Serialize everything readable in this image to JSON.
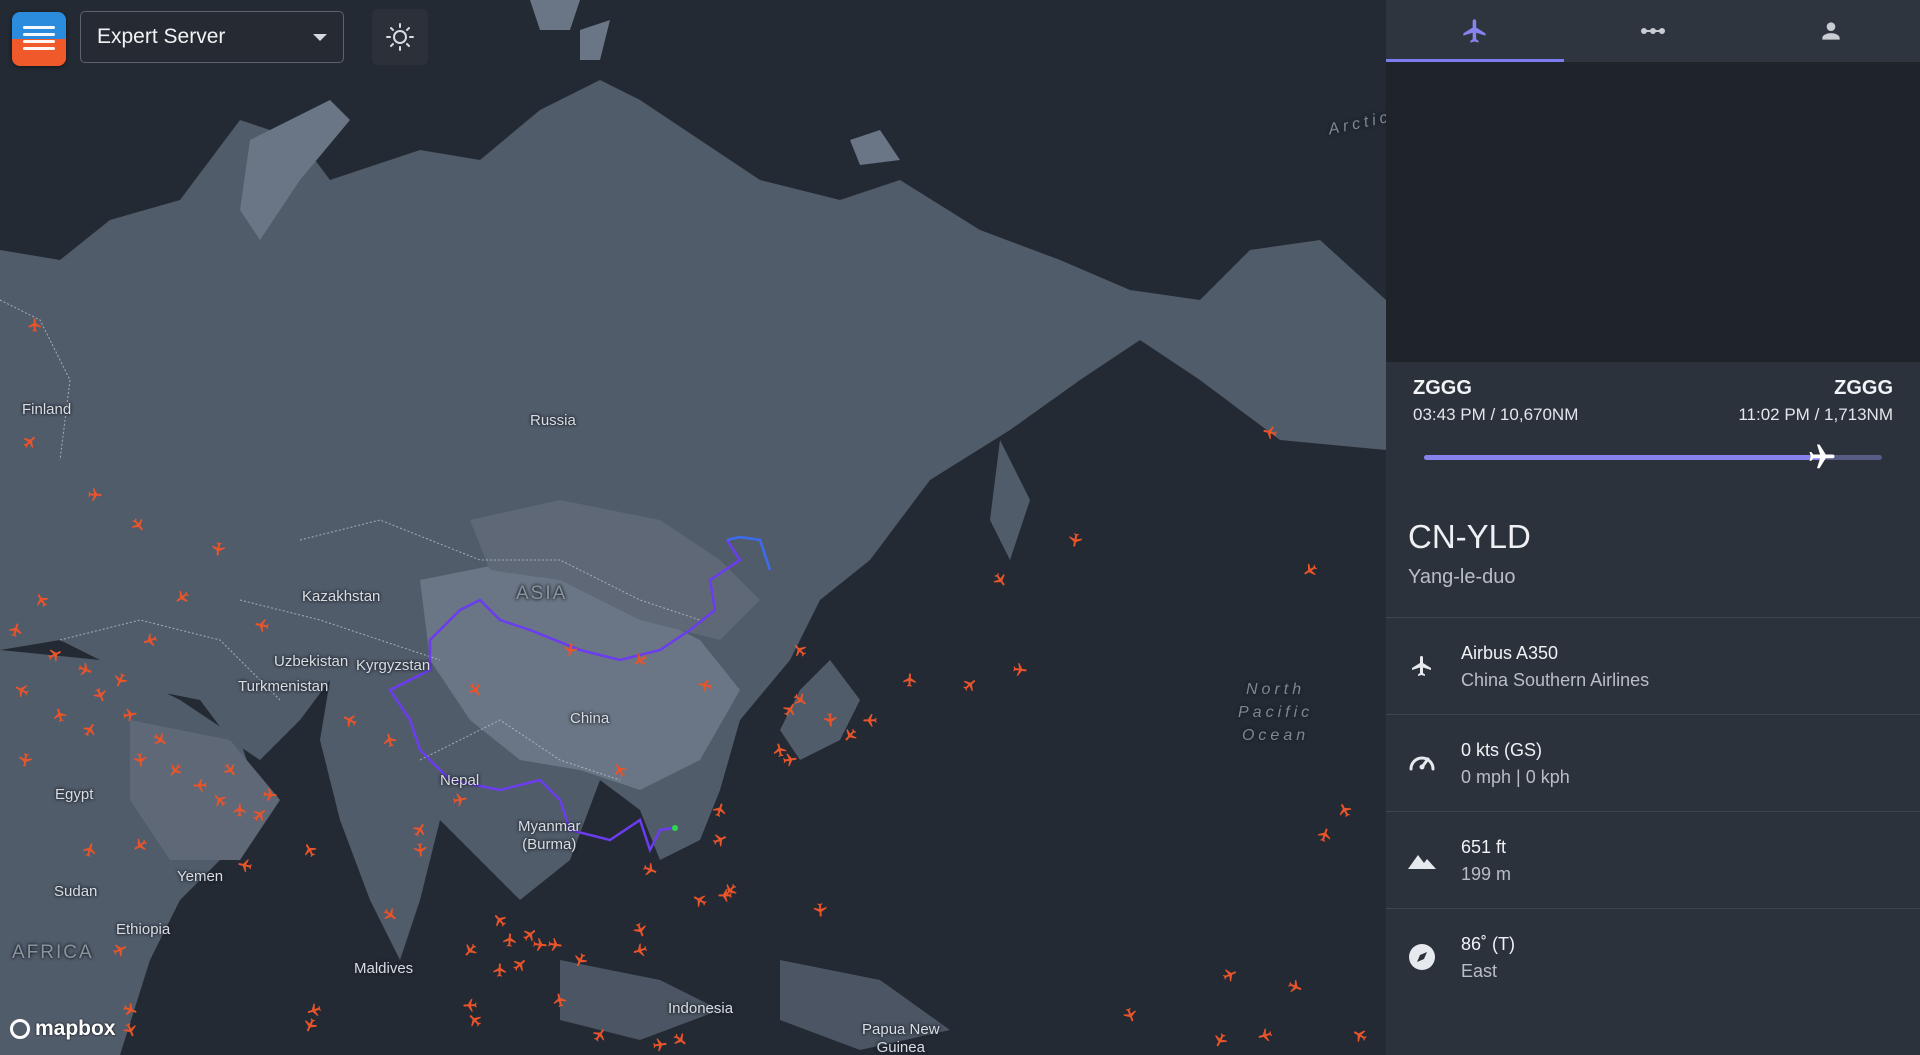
{
  "app": {
    "server_select": {
      "value": "Expert Server"
    }
  },
  "map": {
    "attribution": "mapbox",
    "labels": [
      {
        "text": "Russia",
        "kind": "country"
      },
      {
        "text": "Finland",
        "kind": "country"
      },
      {
        "text": "Kazakhstan",
        "kind": "country"
      },
      {
        "text": "ASIA",
        "kind": "region"
      },
      {
        "text": "Uzbekistan",
        "kind": "country"
      },
      {
        "text": "Kyrgyzstan",
        "kind": "country"
      },
      {
        "text": "Turkmenistan",
        "kind": "country"
      },
      {
        "text": "China",
        "kind": "country"
      },
      {
        "text": "Nepal",
        "kind": "country"
      },
      {
        "text": "Myanmar\n(Burma)",
        "kind": "country"
      },
      {
        "text": "Egypt",
        "kind": "country"
      },
      {
        "text": "Yemen",
        "kind": "country"
      },
      {
        "text": "Sudan",
        "kind": "country"
      },
      {
        "text": "Ethiopia",
        "kind": "country"
      },
      {
        "text": "AFRICA",
        "kind": "region"
      },
      {
        "text": "Maldives",
        "kind": "country"
      },
      {
        "text": "Indonesia",
        "kind": "country"
      },
      {
        "text": "Papua New\nGuinea",
        "kind": "country"
      },
      {
        "text": "North\nPacific\nOcean",
        "kind": "ocean"
      },
      {
        "text": "Arctic",
        "kind": "ocean"
      }
    ],
    "colors": {
      "water": "#232a33",
      "land": "#515c6b",
      "highland": "#6a7585",
      "plane": "#e9542a",
      "route": "#6b3cf0"
    }
  },
  "panel": {
    "tabs": [
      {
        "name": "flight-icon",
        "active": true
      },
      {
        "name": "route-icon",
        "active": false
      },
      {
        "name": "user-icon",
        "active": false
      }
    ],
    "origin": {
      "code": "ZGGG",
      "time_distance": "03:43 PM / 10,670NM"
    },
    "destination": {
      "code": "ZGGG",
      "time_distance": "11:02 PM / 1,713NM"
    },
    "progress_fraction": 0.87,
    "registration": "CN-YLD",
    "owner": "Yang-le-duo",
    "aircraft": {
      "line1": "Airbus A350",
      "line2": "China Southern Airlines",
      "icon": "airplane-icon"
    },
    "speed": {
      "line1": "0 kts (GS)",
      "line2": "0 mph | 0 kph",
      "icon": "speedometer-icon"
    },
    "altitude": {
      "line1": "651 ft",
      "line2": "199 m",
      "icon": "mountain-icon"
    },
    "heading": {
      "line1": "86˚ (T)",
      "line2": "East",
      "icon": "compass-icon"
    },
    "accent_color": "#7c7bf0"
  }
}
